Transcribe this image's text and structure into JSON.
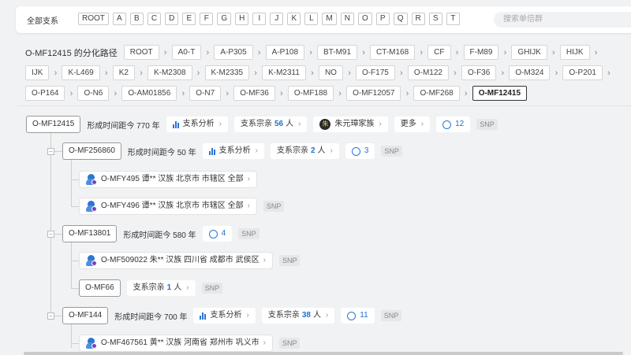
{
  "filter": {
    "label": "全部支系",
    "letters": [
      "ROOT",
      "A",
      "B",
      "C",
      "D",
      "E",
      "F",
      "G",
      "H",
      "I",
      "J",
      "K",
      "L",
      "M",
      "N",
      "O",
      "P",
      "Q",
      "R",
      "S",
      "T"
    ],
    "search_placeholder": "搜索单倍群"
  },
  "path": {
    "title": "O-MF12415 的分化路径",
    "rows": [
      [
        "ROOT",
        "A0-T",
        "A-P305",
        "A-P108",
        "BT-M91",
        "CT-M168",
        "CF",
        "F-M89",
        "GHIJK",
        "HIJK"
      ],
      [
        "IJK",
        "K-L469",
        "K2",
        "K-M2308",
        "K-M2335",
        "K-M2311",
        "NO",
        "O-F175",
        "O-M122",
        "O-F36",
        "O-M324",
        "O-P201"
      ],
      [
        "O-P164",
        "O-N6",
        "O-AM01856",
        "O-N7",
        "O-MF36",
        "O-MF188",
        "O-MF12057",
        "O-MF268",
        "O-MF12415"
      ]
    ]
  },
  "tree": {
    "root": {
      "name": "O-MF12415",
      "age": "形成时间距今 770 年",
      "analysis": "支系分析",
      "clan_label": "支系宗亲",
      "clan_count": "56",
      "clan_unit": "人",
      "family_icon_char": "朱",
      "family": "朱元璋家族",
      "more": "更多",
      "comments": "12",
      "snp": "SNP"
    },
    "c1": {
      "name": "O-MF256860",
      "age": "形成时间距今 50 年",
      "analysis": "支系分析",
      "clan_label": "支系宗亲",
      "clan_count": "2",
      "clan_unit": "人",
      "comments": "3",
      "snp": "SNP"
    },
    "s1": {
      "text": "O-MFY495 谭** 汉族 北京市 市辖区 全部"
    },
    "s2": {
      "text": "O-MFY496 谭** 汉族 北京市 市辖区 全部",
      "snp": "SNP"
    },
    "c2": {
      "name": "O-MF13801",
      "age": "形成时间距今 580 年",
      "comments": "4",
      "snp": "SNP"
    },
    "s3": {
      "text": "O-MF509022 朱** 汉族 四川省 成都市 武侯区",
      "snp": "SNP"
    },
    "c3": {
      "name": "O-MF66",
      "clan_label": "支系宗亲",
      "clan_count": "1",
      "clan_unit": "人",
      "snp": "SNP"
    },
    "c4": {
      "name": "O-MF144",
      "age": "形成时间距今 700 年",
      "analysis": "支系分析",
      "clan_label": "支系宗亲",
      "clan_count": "38",
      "clan_unit": "人",
      "comments": "11",
      "snp": "SNP"
    },
    "s4": {
      "text": "O-MF467561 黄** 汉族 河南省 郑州市 巩义市",
      "snp": "SNP"
    }
  },
  "colors": {
    "accent": "#2a77d4",
    "count": "#1f6fd1"
  }
}
